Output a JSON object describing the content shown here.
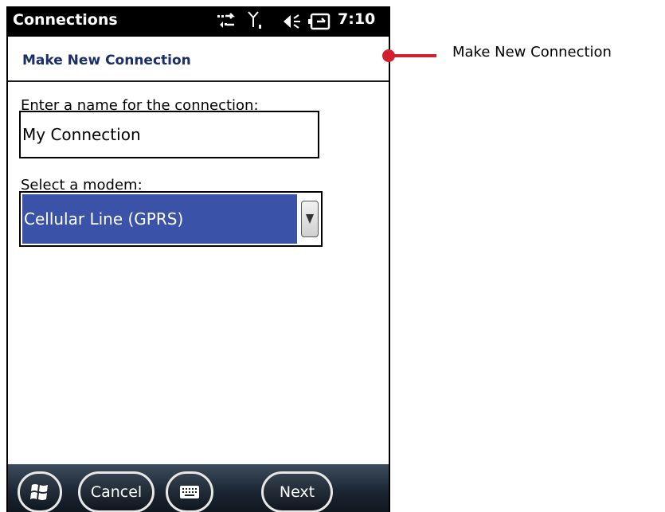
{
  "status_bar": {
    "app_title": "Connections",
    "clock": "7:10",
    "icons": [
      "data-transfer-icon",
      "signal-strength-icon",
      "speaker-icon",
      "battery-icon"
    ]
  },
  "header": {
    "title": "Make New Connection"
  },
  "form": {
    "name_label": "Enter a name for the connection:",
    "name_value": "My Connection",
    "modem_label": "Select a modem:",
    "modem_selected": "Cellular Line (GPRS)"
  },
  "toolbar": {
    "start_icon": "windows-logo-icon",
    "cancel_label": "Cancel",
    "keyboard_icon": "keyboard-icon",
    "next_label": "Next"
  },
  "callout": {
    "label": "Make New Connection",
    "color": "#d2202e"
  },
  "colors": {
    "header_text": "#1a2e6b",
    "selection": "#3a53a8",
    "titlebar": "#000000"
  }
}
